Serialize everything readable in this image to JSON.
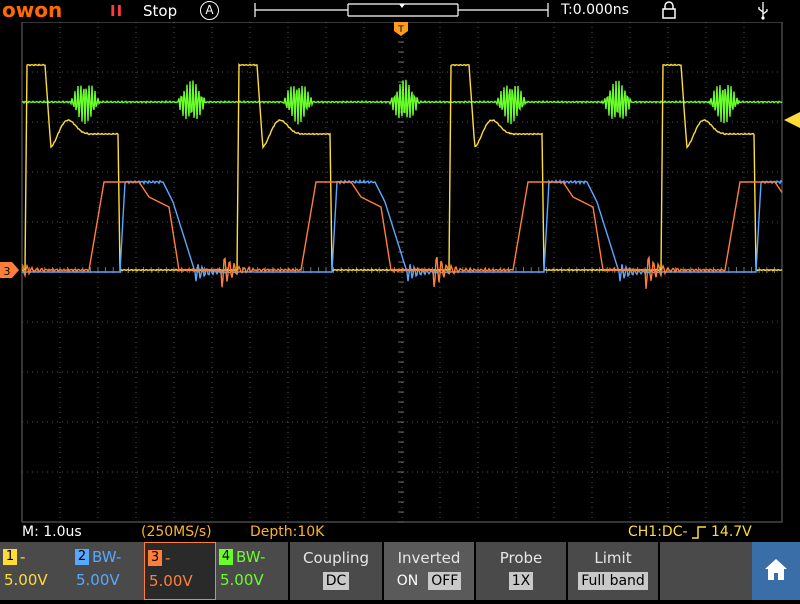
{
  "colors": {
    "ch1": "#ffdc3a",
    "ch2": "#58a8ff",
    "ch3": "#ff7f3a",
    "ch4": "#6aff2a",
    "brand": "#ff6a00",
    "grid": "#6a6a6a"
  },
  "top": {
    "brand_text": "owon",
    "run_icon": "pause-bars-icon",
    "state": "Stop",
    "mode_letter": "A",
    "trigger_time": "T:0.000ns",
    "icons": [
      "lock-icon",
      "usb-icon"
    ]
  },
  "screen_markers": {
    "trigger_position_label": "T",
    "ch3_marker": "3"
  },
  "status": {
    "timebase": "M: 1.0us",
    "sample_rate": "(250MS/s)",
    "depth": "Depth:10K",
    "trigger": "CH1:DC-",
    "trigger_level": "14.7V"
  },
  "channels": [
    {
      "num": "1",
      "mode": "-",
      "scale": "5.00V"
    },
    {
      "num": "2",
      "mode": "BW-",
      "scale": "5.00V"
    },
    {
      "num": "3",
      "mode": "-",
      "scale": "5.00V"
    },
    {
      "num": "4",
      "mode": "BW-",
      "scale": "5.00V"
    }
  ],
  "menu": {
    "coupling": {
      "label": "Coupling",
      "value": "DC"
    },
    "inverted": {
      "label": "Inverted",
      "on": "ON",
      "off": "OFF"
    },
    "probe": {
      "label": "Probe",
      "value": "1X"
    },
    "limit": {
      "label": "Limit",
      "value": "Full band"
    },
    "home_icon": "home-icon"
  }
}
